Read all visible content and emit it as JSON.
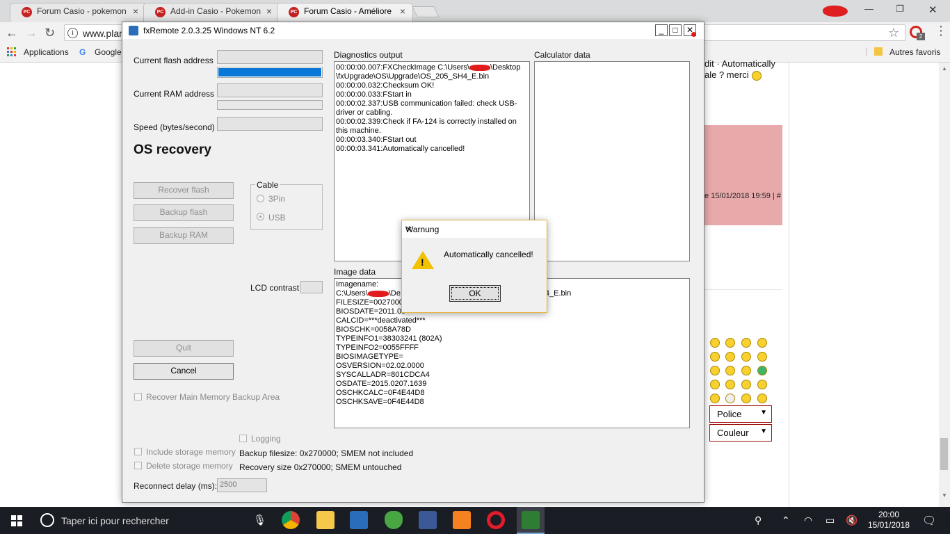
{
  "browser": {
    "tabs": [
      {
        "title": "Forum Casio - pokemon",
        "favicon": "PC"
      },
      {
        "title": "Add-in Casio - Pokemon",
        "favicon": "PC"
      },
      {
        "title": "Forum Casio - Améliore",
        "favicon": "PC"
      }
    ],
    "url": "www.plar",
    "extension_badge": "2",
    "bookmarks": {
      "apps": "Applications",
      "google": "Google",
      "others": "Autres favoris"
    }
  },
  "page_behind": {
    "text_line1": "dit · Automatically",
    "text_line2": "ale ? merci",
    "post_date": "e 15/01/2018 19:59 | #",
    "select_police": "Police",
    "select_couleur": "Couleur"
  },
  "fxremote": {
    "title": "fxRemote 2.0.3.25 Windows NT 6.2",
    "labels": {
      "flash_address": "Current flash address",
      "ram_address": "Current RAM address",
      "speed": "Speed (bytes/second)",
      "mode_heading": "OS recovery",
      "cable_group": "Cable",
      "cable_3pin": "3Pin",
      "cable_usb": "USB",
      "lcd_contrast": "LCD contrast",
      "diagnostics": "Diagnostics output",
      "calculator": "Calculator data",
      "image_data": "Image data",
      "recover_main_memory": "Recover Main Memory Backup Area",
      "logging": "Logging",
      "include_storage": "Include storage memory",
      "delete_storage": "Delete storage memory",
      "backup_filesize": "Backup filesize: 0x270000; SMEM not included",
      "recovery_size": "Recovery size 0x270000; SMEM untouched",
      "reconnect_delay": "Reconnect delay (ms):"
    },
    "progress": {
      "flash_fill": 1.0
    },
    "buttons": {
      "recover_flash": "Recover flash",
      "backup_flash": "Backup flash",
      "backup_ram": "Backup RAM",
      "quit": "Quit",
      "cancel": "Cancel"
    },
    "reconnect_delay_value": "2500",
    "diagnostics_lines": [
      "00:00:00.007:FXCheckImage C:\\Users\\",
      "\\Desktop",
      "\\fxUpgrade\\OS\\Upgrade\\OS_205_SH4_E.bin",
      "00:00:00.032:Checksum OK!",
      "00:00:00.033:FStart in",
      "00:00:02.337:USB communication failed: check USB-driver or cabling.",
      "00:00:02.339:Check if FA-124 is correctly installed on this machine.",
      "00:00:03.340:FStart out",
      "00:00:03.341:Automatically cancelled!"
    ],
    "image_lines": [
      "Imagename:",
      "C:\\Users\\",
      "\\De",
      "H4_E.bin",
      "FILESIZE=0027000",
      "BIOSDATE=2011.05",
      "CALCID=***deactivated***",
      "BIOSCHK=0058A78D",
      "TYPEINFO1=38303241 (802A)",
      "TYPEINFO2=0055FFFF",
      "BIOSIMAGETYPE=",
      "OSVERSION=02.02.0000",
      "SYSCALLADR=801CDCA4",
      "OSDATE=2015.0207.1639",
      "OSCHKCALC=0F4E44D8",
      "OSCHKSAVE=0F4E44D8"
    ]
  },
  "dialog": {
    "title": "Warnung",
    "message": "Automatically cancelled!",
    "ok": "OK"
  },
  "taskbar": {
    "search_placeholder": "Taper ici pour rechercher",
    "time": "20:00",
    "date": "15/01/2018"
  }
}
